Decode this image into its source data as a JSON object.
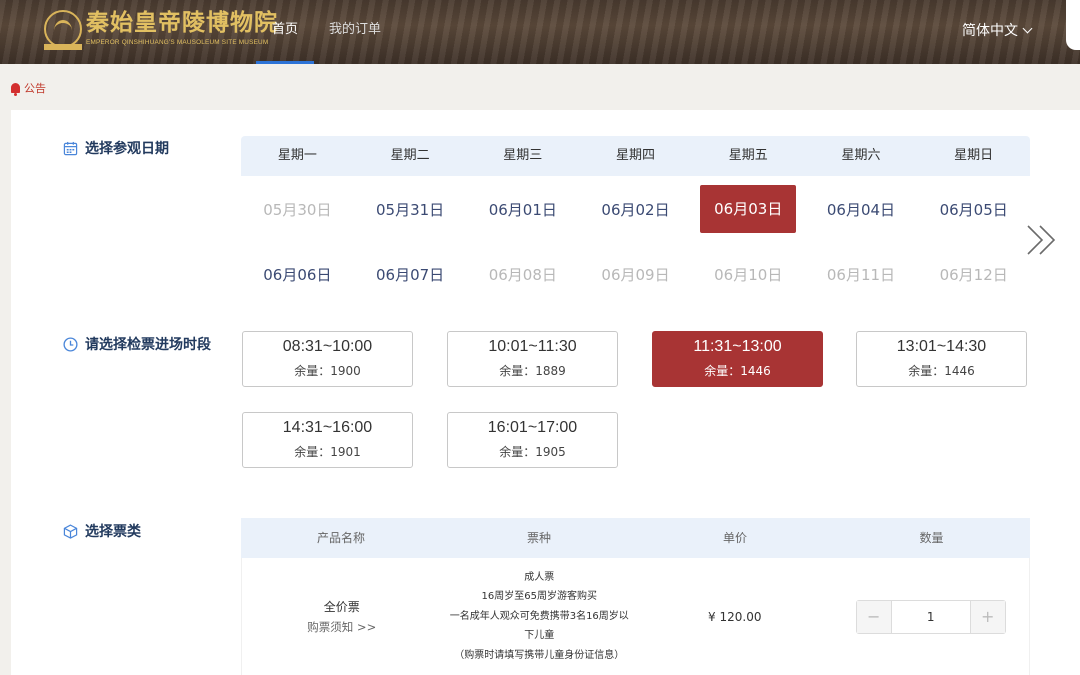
{
  "header": {
    "logo_title": "秦始皇帝陵博物院",
    "logo_subtitle": "EMPEROR QINSHIHUANG'S MAUSOLEUM SITE MUSEUM",
    "nav": [
      {
        "label": "首页"
      },
      {
        "label": "我的订单"
      }
    ],
    "language": "简体中文"
  },
  "notice": {
    "label": "公告"
  },
  "date_section": {
    "label": "选择参观日期",
    "weekdays": [
      "星期一",
      "星期二",
      "星期三",
      "星期四",
      "星期五",
      "星期六",
      "星期日"
    ],
    "rows": [
      [
        {
          "label": "05月30日",
          "state": "disabled"
        },
        {
          "label": "05月31日",
          "state": "available"
        },
        {
          "label": "06月01日",
          "state": "available"
        },
        {
          "label": "06月02日",
          "state": "available"
        },
        {
          "label": "06月03日",
          "state": "selected"
        },
        {
          "label": "06月04日",
          "state": "available"
        },
        {
          "label": "06月05日",
          "state": "available"
        }
      ],
      [
        {
          "label": "06月06日",
          "state": "available"
        },
        {
          "label": "06月07日",
          "state": "available"
        },
        {
          "label": "06月08日",
          "state": "disabled"
        },
        {
          "label": "06月09日",
          "state": "disabled"
        },
        {
          "label": "06月10日",
          "state": "disabled"
        },
        {
          "label": "06月11日",
          "state": "disabled"
        },
        {
          "label": "06月12日",
          "state": "disabled"
        }
      ]
    ]
  },
  "time_section": {
    "label": "请选择检票进场时段",
    "slots": [
      {
        "time": "08:31~10:00",
        "remain": "余量：1900",
        "selected": false
      },
      {
        "time": "10:01~11:30",
        "remain": "余量：1889",
        "selected": false
      },
      {
        "time": "11:31~13:00",
        "remain": "余量：1446",
        "selected": true
      },
      {
        "time": "13:01~14:30",
        "remain": "余量：1446",
        "selected": false
      },
      {
        "time": "14:31~16:00",
        "remain": "余量：1901",
        "selected": false
      },
      {
        "time": "16:01~17:00",
        "remain": "余量：1905",
        "selected": false
      }
    ]
  },
  "ticket_section": {
    "label": "选择票类",
    "columns": [
      "产品名称",
      "票种",
      "单价",
      "数量"
    ],
    "rows": [
      {
        "product_name": "全价票",
        "product_link": "购票须知 >>",
        "ticket_type_lines": [
          "成人票",
          "16周岁至65周岁游客购买",
          "一名成年人观众可免费携带3名16周岁以",
          "下儿童",
          "（购票时请填写携带儿童身份证信息）"
        ],
        "price": "¥ 120.00",
        "quantity": "1",
        "minus": "−",
        "plus": "+"
      }
    ]
  },
  "colors": {
    "accent": "#a83434",
    "header_bg": "#4a3b30",
    "table_head_bg": "#eaf1fa",
    "nav_active": "#2d73d6"
  }
}
